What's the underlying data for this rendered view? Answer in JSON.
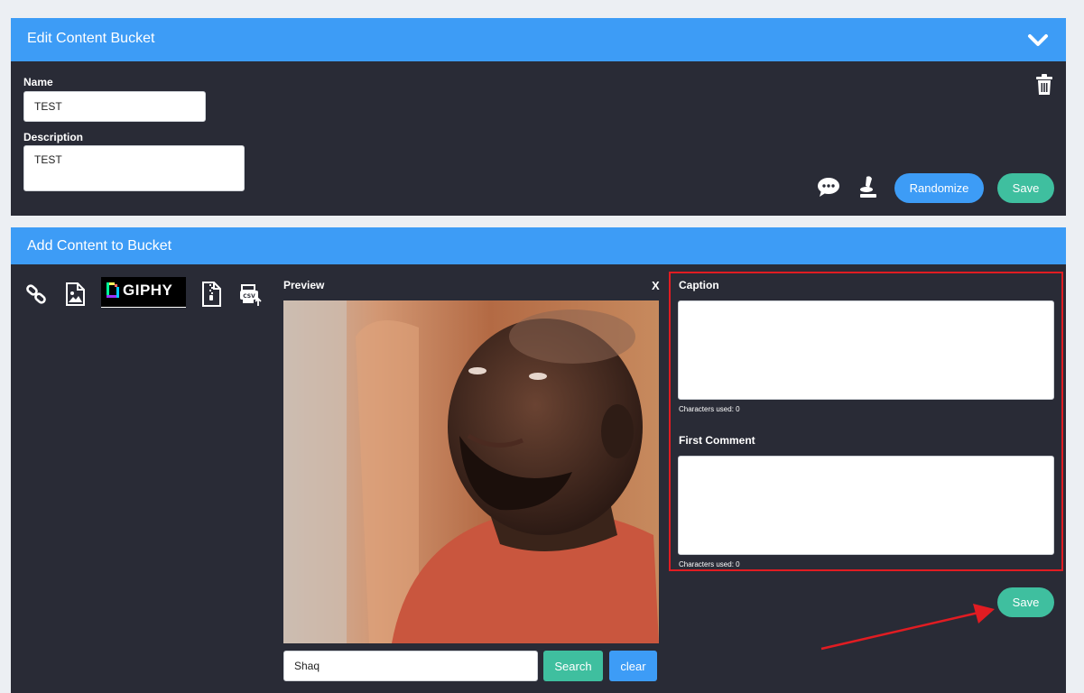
{
  "edit_section": {
    "title": "Edit Content Bucket",
    "name_label": "Name",
    "name_value": "TEST",
    "description_label": "Description",
    "description_value": "TEST",
    "randomize_label": "Randomize",
    "save_label": "Save"
  },
  "add_section": {
    "title": "Add Content to Bucket",
    "giphy_label": "GIPHY",
    "preview_label": "Preview",
    "close_label": "X",
    "caption_label": "Caption",
    "caption_value": "",
    "caption_chars": "Characters used: 0",
    "first_comment_label": "First Comment",
    "first_comment_value": "",
    "first_comment_chars": "Characters used: 0",
    "save_label": "Save",
    "search_value": "Shaq",
    "search_label": "Search",
    "clear_label": "clear"
  },
  "colors": {
    "accent_blue": "#3d9cf6",
    "panel_dark": "#292b36",
    "save_green": "#3fbf9f",
    "highlight_red": "#e11c22"
  }
}
